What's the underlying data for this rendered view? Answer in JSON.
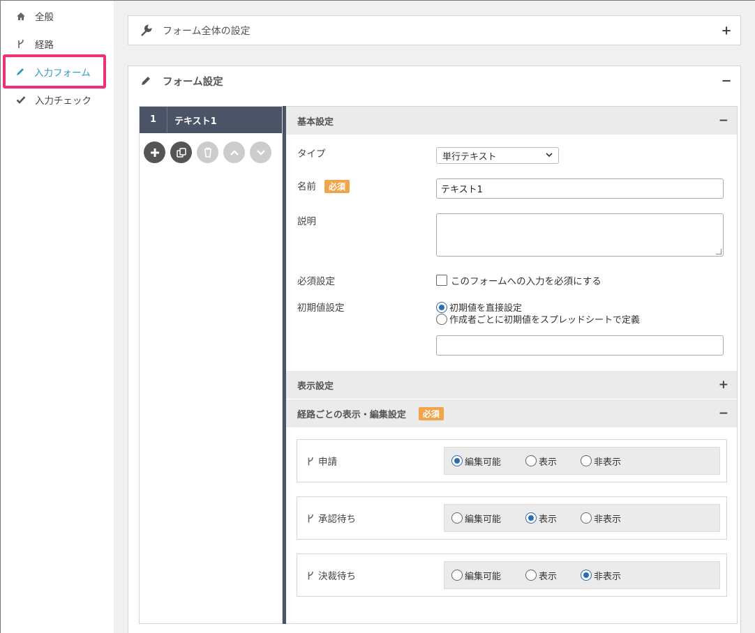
{
  "sidebar": {
    "items": [
      {
        "label": "全般",
        "icon": "home-icon"
      },
      {
        "label": "経路",
        "icon": "branch-icon"
      },
      {
        "label": "入力フォーム",
        "icon": "pencil-icon",
        "active": true
      },
      {
        "label": "入力チェック",
        "icon": "check-icon"
      }
    ]
  },
  "form_overall": {
    "title": "フォーム全体の設定",
    "toggle": "+"
  },
  "form_settings": {
    "title": "フォーム設定",
    "toggle": "−"
  },
  "field_list": {
    "items": [
      {
        "num": "1",
        "name": "テキスト1"
      }
    ]
  },
  "basic": {
    "title": "基本設定",
    "toggle": "−",
    "type_label": "タイプ",
    "type_value": "単行テキスト",
    "name_label": "名前",
    "required_badge": "必須",
    "name_value": "テキスト1",
    "desc_label": "説明",
    "required_label": "必須設定",
    "required_checkbox": "このフォームへの入力を必須にする",
    "initial_label": "初期値設定",
    "initial_opt1": "初期値を直接設定",
    "initial_opt2": "作成者ごとに初期値をスプレッドシートで定義"
  },
  "display": {
    "title": "表示設定",
    "toggle": "+"
  },
  "route_settings": {
    "title": "経路ごとの表示・編集設定",
    "badge": "必須",
    "toggle": "−",
    "options": [
      "編集可能",
      "表示",
      "非表示"
    ],
    "routes": [
      {
        "name": "申請",
        "selected": 0
      },
      {
        "name": "承認待ち",
        "selected": 1
      },
      {
        "name": "決裁待ち",
        "selected": 2
      }
    ]
  },
  "colors": {
    "accent": "#2b9ac9",
    "highlight": "#ef2f78",
    "badge": "#f0a44b",
    "dark": "#4a5466"
  }
}
